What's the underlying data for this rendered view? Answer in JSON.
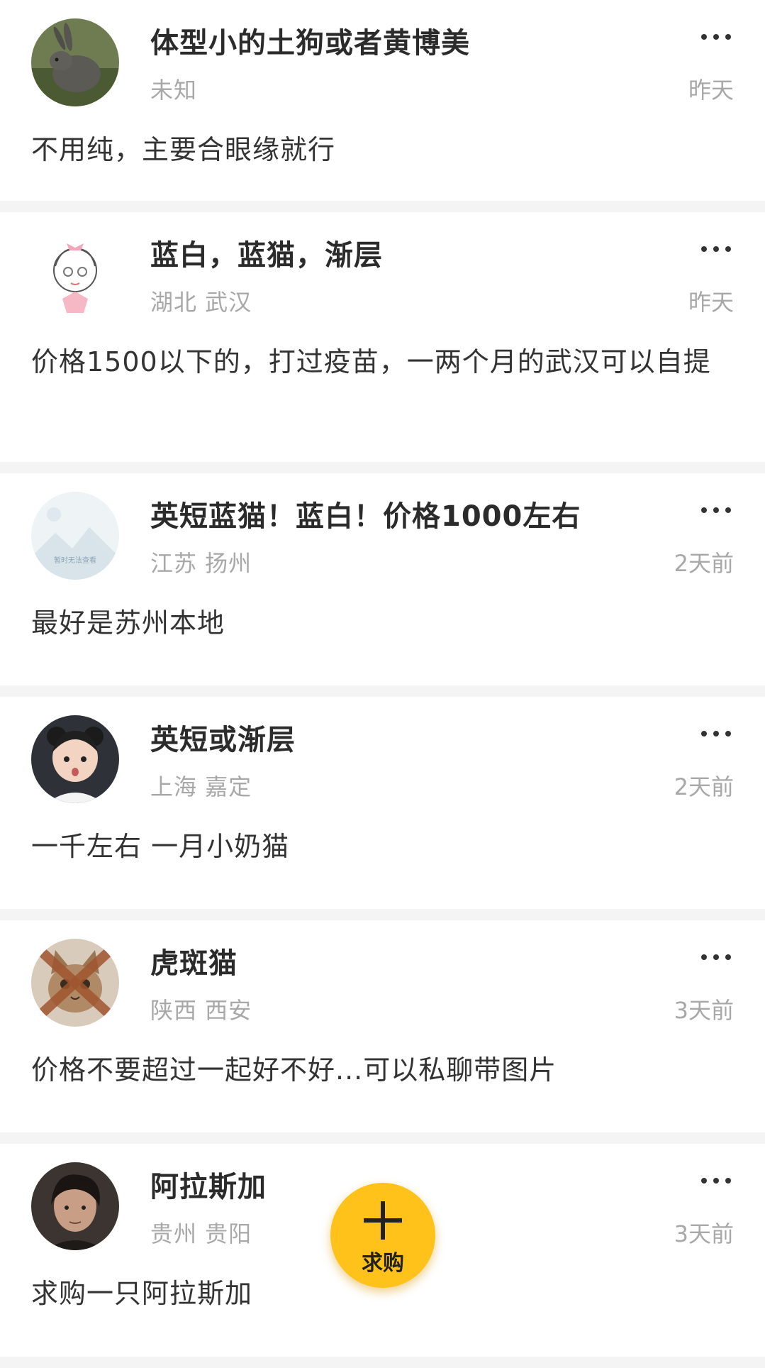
{
  "posts": [
    {
      "title": "体型小的土狗或者黄博美",
      "location": "未知",
      "time": "昨天",
      "content": "不用纯，主要合眼缘就行",
      "avatar_icon": "rabbit-photo-avatar"
    },
    {
      "title": "蓝白，蓝猫，渐层",
      "location": "湖北 武汉",
      "time": "昨天",
      "content": "价格1500以下的，打过疫苗，一两个月的武汉可以自提",
      "avatar_icon": "cartoon-girl-avatar"
    },
    {
      "title": "英短蓝猫！蓝白！价格1000左右",
      "location": "江苏 扬州",
      "time": "2天前",
      "content": "最好是苏州本地",
      "avatar_icon": "image-unavailable-avatar",
      "avatar_caption": "暂时无法查看"
    },
    {
      "title": "英短或渐层",
      "location": "上海 嘉定",
      "time": "2天前",
      "content": "一千左右 一月小奶猫",
      "avatar_icon": "child-photo-avatar"
    },
    {
      "title": "虎斑猫",
      "location": "陕西 西安",
      "time": "3天前",
      "content": "价格不要超过一起好不好...可以私聊带图片",
      "avatar_icon": "kitten-photo-avatar"
    },
    {
      "title": "阿拉斯加",
      "location": "贵州 贵阳",
      "time": "3天前",
      "content": "求购一只阿拉斯加",
      "avatar_icon": "man-photo-avatar"
    }
  ],
  "fab": {
    "label": "求购",
    "icon": "plus-icon",
    "color": "#ffc21a"
  },
  "colors": {
    "title": "#2b2b2b",
    "secondary": "#a8a8a8",
    "background": "#f4f4f4"
  }
}
